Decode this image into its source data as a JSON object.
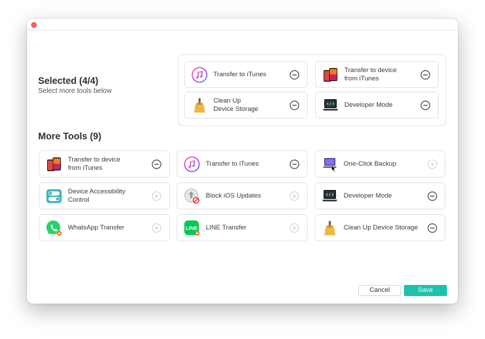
{
  "selected": {
    "title": "Selected (4/4)",
    "subtitle": "Select more tools below"
  },
  "selected_tools": [
    {
      "label": "Transfer to iTunes",
      "icon": "itunes-icon",
      "action": "remove"
    },
    {
      "label": "Transfer to device\nfrom iTunes",
      "icon": "device-transfer-icon",
      "action": "remove"
    },
    {
      "label": "Clean Up\nDevice Storage",
      "icon": "broom-icon",
      "action": "remove"
    },
    {
      "label": "Developer Mode",
      "icon": "developer-icon",
      "action": "remove"
    }
  ],
  "more": {
    "title": "More Tools (9)"
  },
  "more_tools": [
    {
      "label": "Transfer to device\nfrom iTunes",
      "icon": "device-transfer-icon",
      "action": "remove"
    },
    {
      "label": "Transfer to iTunes",
      "icon": "itunes-icon",
      "action": "remove"
    },
    {
      "label": "One-Click Backup",
      "icon": "backup-icon",
      "action": "add"
    },
    {
      "label": "Device Accessibility\nControl",
      "icon": "accessibility-icon",
      "action": "add"
    },
    {
      "label": "Block iOS Updates",
      "icon": "block-update-icon",
      "action": "add"
    },
    {
      "label": "Developer Mode",
      "icon": "developer-icon",
      "action": "remove"
    },
    {
      "label": "WhatsApp Transfer",
      "icon": "whatsapp-icon",
      "action": "add"
    },
    {
      "label": "LINE Transfer",
      "icon": "line-icon",
      "action": "add"
    },
    {
      "label": "Clean Up Device Storage",
      "icon": "broom-icon",
      "action": "remove"
    }
  ],
  "footer": {
    "cancel_label": "Cancel",
    "save_label": "Save"
  },
  "colors": {
    "accent": "#1ec2ac",
    "close": "#fd5f57",
    "itunes": "#c74cf0",
    "line": "#06c755",
    "whatsapp": "#25d366"
  }
}
